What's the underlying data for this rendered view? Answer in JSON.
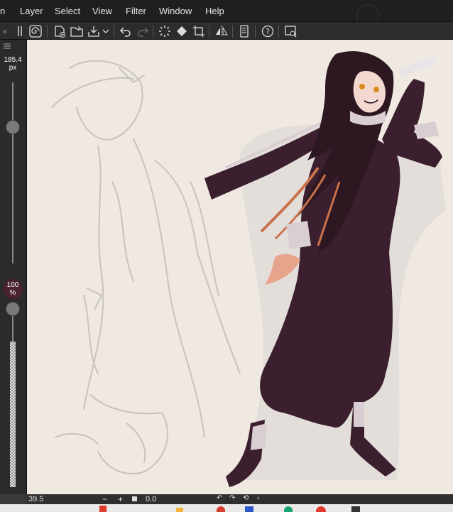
{
  "menu": {
    "items": [
      "n",
      "Layer",
      "Select",
      "View",
      "Filter",
      "Window",
      "Help"
    ]
  },
  "toolbar": {
    "icons": [
      "spiral-icon",
      "new-file-icon",
      "open-folder-icon",
      "save-icon",
      "dropdown-arrow",
      "undo-icon",
      "redo-icon",
      "loading-spinner-icon",
      "fill-icon",
      "transform-icon",
      "flip-horizontal-icon",
      "panel-icon",
      "help-icon",
      "canvas-view-icon"
    ]
  },
  "left_panel": {
    "collapse_label": "«",
    "brush_size_value": "185.4",
    "brush_size_unit": "px",
    "opacity_value": "100",
    "opacity_unit": "%"
  },
  "status": {
    "zoom": "39.5",
    "minus": "−",
    "plus": "+",
    "rotation": "0.0"
  },
  "colors": {
    "menu_bg": "#1f1f1f",
    "toolbar_bg": "#2c2c2c",
    "canvas_bg": "#efe9e2",
    "opacity_badge": "#4a2232",
    "character_dress": "#3b1f2e",
    "hair_accent": "#c9714c"
  }
}
